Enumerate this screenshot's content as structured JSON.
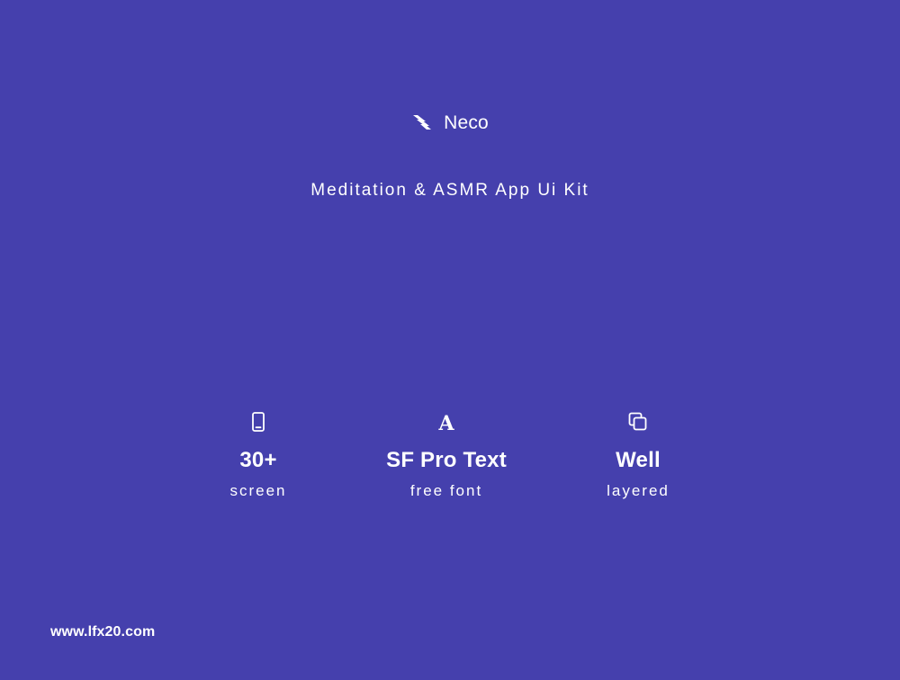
{
  "brand": {
    "name": "Neco",
    "logo_icon": "striped-logo-icon"
  },
  "tagline": "Meditation & ASMR App Ui Kit",
  "features": [
    {
      "icon": "smartphone-icon",
      "title": "30+",
      "subtitle": "screen"
    },
    {
      "icon": "font-letter-icon",
      "icon_text": "A",
      "title": "SF Pro Text",
      "subtitle": "free font"
    },
    {
      "icon": "layers-icon",
      "title": "Well",
      "subtitle": "layered"
    }
  ],
  "footer": {
    "watermark": "www.lfx20.com"
  },
  "colors": {
    "background": "#4540ad",
    "text": "#ffffff"
  }
}
